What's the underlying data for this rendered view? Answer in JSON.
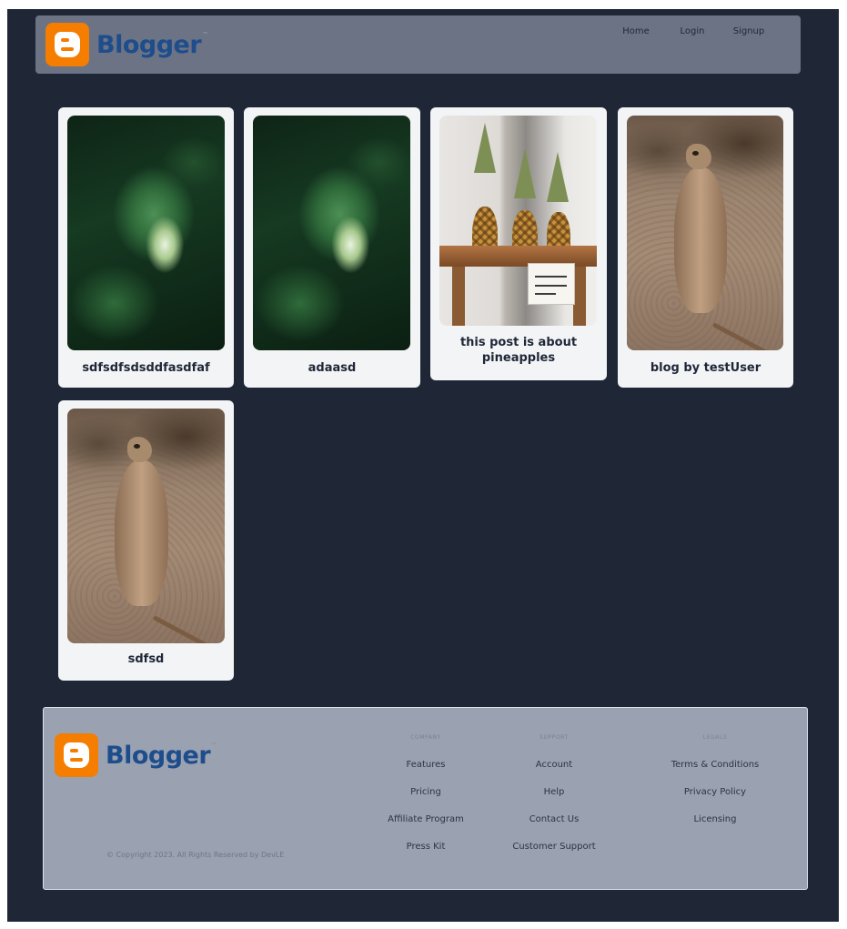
{
  "brand": {
    "name": "Blogger",
    "mark": "™"
  },
  "nav": {
    "home": "Home",
    "login": "Login",
    "signup": "Signup"
  },
  "posts": [
    {
      "title": "sdfsdfsdsddfasdfaf",
      "image": "monstera-leaf-photo"
    },
    {
      "title": "adaasd",
      "image": "monstera-leaf-photo"
    },
    {
      "title": "this post is about pineapples",
      "image": "pineapples-photo"
    },
    {
      "title": "blog by testUser",
      "image": "meerkat-photo"
    },
    {
      "title": "sdfsd",
      "image": "meerkat-photo"
    }
  ],
  "footer": {
    "copyright": "© Copyright 2023. All Rights Reserved by DevLE",
    "company": {
      "heading": "COMPANY",
      "links": [
        "Features",
        "Pricing",
        "Affiliate Program",
        "Press Kit"
      ]
    },
    "support": {
      "heading": "SUPPORT",
      "links": [
        "Account",
        "Help",
        "Contact Us",
        "Customer Support"
      ]
    },
    "legals": {
      "heading": "LEGALS",
      "links": [
        "Terms & Conditions",
        "Privacy Policy",
        "Licensing"
      ]
    }
  },
  "colors": {
    "page_bg": "#1f2737",
    "header_bg": "#6c7385",
    "card_bg": "#f3f4f6",
    "footer_bg": "#9aa1b1",
    "brand_orange": "#f57d00",
    "brand_text": "#1e4d8c"
  }
}
